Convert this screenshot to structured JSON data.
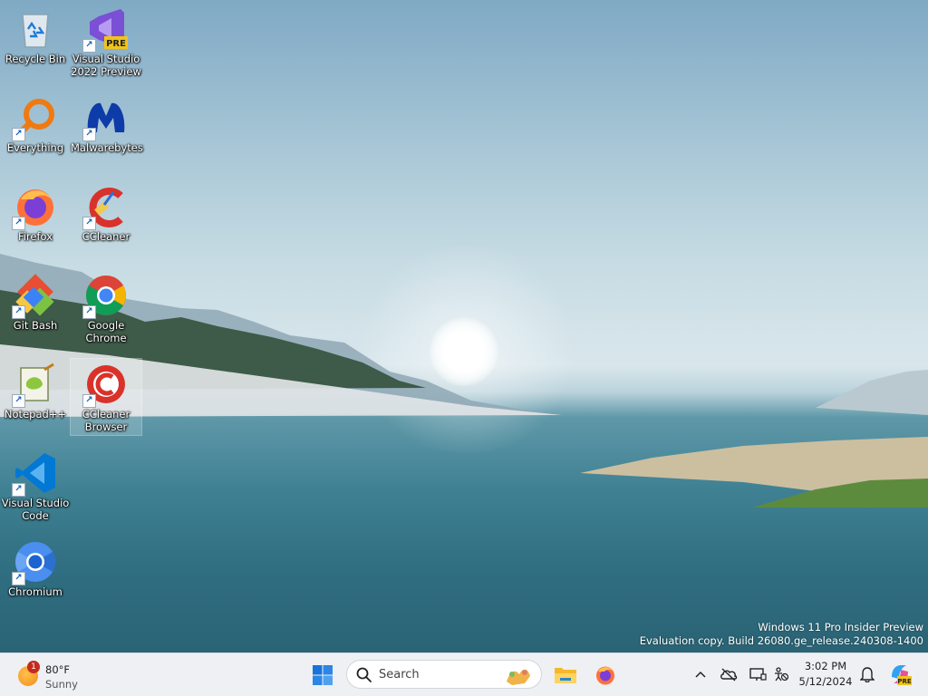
{
  "desktop": {
    "icons": [
      {
        "label": "Recycle Bin"
      },
      {
        "label": "Visual Studio 2022 Preview",
        "badge": "PRE"
      },
      {
        "label": "Everything"
      },
      {
        "label": "Malwarebytes"
      },
      {
        "label": "Firefox"
      },
      {
        "label": "CCleaner"
      },
      {
        "label": "Git Bash"
      },
      {
        "label": "Google Chrome"
      },
      {
        "label": "Notepad++"
      },
      {
        "label": "CCleaner Browser"
      },
      {
        "label": "Visual Studio Code"
      },
      {
        "label": "Chromium"
      }
    ],
    "watermark": {
      "line1": "Windows 11 Pro Insider Preview",
      "line2": "Evaluation copy. Build 26080.ge_release.240308-1400"
    }
  },
  "taskbar": {
    "weather": {
      "badge": "1",
      "temperature": "80°F",
      "condition": "Sunny"
    },
    "search": {
      "placeholder": "Search"
    },
    "pinned": [
      "start-icon",
      "file-explorer-icon",
      "firefox-icon"
    ],
    "tray": {
      "icons": [
        "chevron-up-icon",
        "onedrive-offline-icon",
        "network-icon",
        "accessibility-icon",
        "notification-bell-icon",
        "copilot-icon"
      ],
      "copilot_badge": "PRE"
    },
    "clock": {
      "time": "3:02 PM",
      "date": "5/12/2024"
    }
  },
  "colors": {
    "taskbar_bg": "#eef0f3",
    "accent": "#0067c0"
  }
}
